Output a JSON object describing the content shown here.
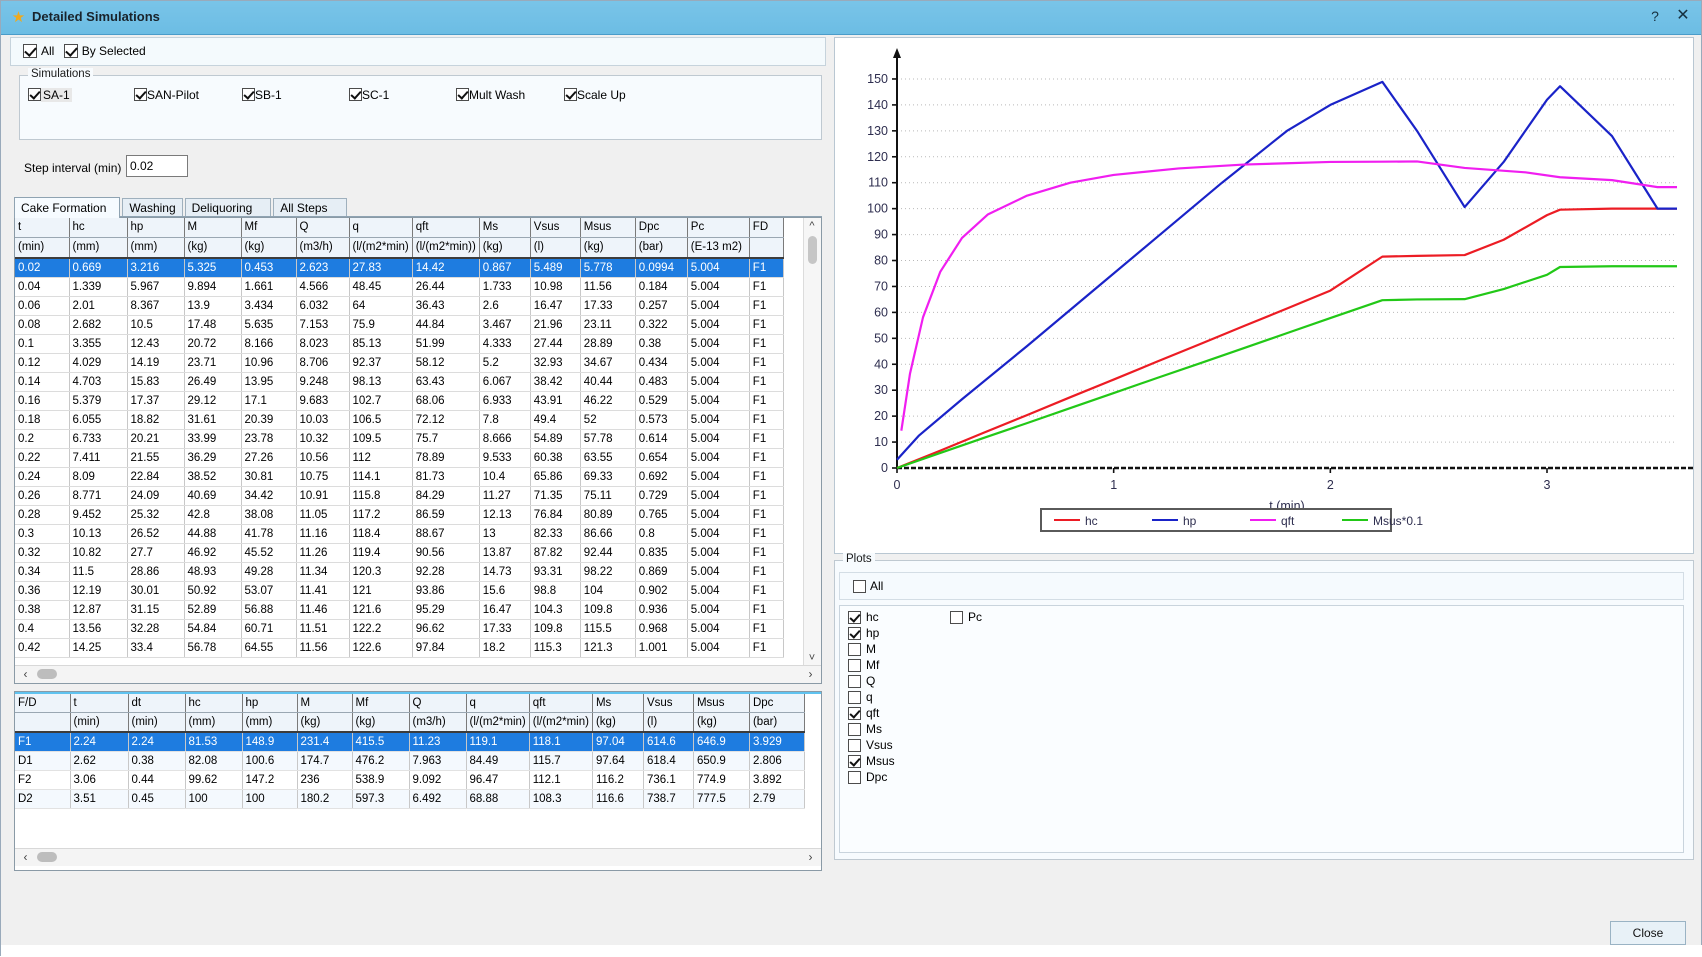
{
  "window": {
    "title": "Detailed Simulations",
    "star_icon": "star-icon",
    "help_label": "?",
    "close_label": "✕"
  },
  "top_filters": {
    "all_label": "All",
    "all_checked": true,
    "by_selected_label": "By Selected",
    "by_selected_checked": true
  },
  "simulations": {
    "group_title": "Simulations",
    "items": [
      {
        "label": "SA-1",
        "checked": true,
        "highlighted": true
      },
      {
        "label": "SAN-Pilot",
        "checked": true,
        "highlighted": false
      },
      {
        "label": "SB-1",
        "checked": true,
        "highlighted": false
      },
      {
        "label": "SC-1",
        "checked": true,
        "highlighted": false
      },
      {
        "label": "Mult Wash",
        "checked": true,
        "highlighted": false
      },
      {
        "label": "Scale Up",
        "checked": true,
        "highlighted": false
      }
    ]
  },
  "step_interval": {
    "label": "Step interval (min)",
    "value": "0.02"
  },
  "tabs": [
    {
      "label": "Cake Formation",
      "active": true
    },
    {
      "label": "Washing",
      "active": false
    },
    {
      "label": "Deliquoring",
      "active": false
    },
    {
      "label": "All Steps",
      "active": false
    }
  ],
  "main_table": {
    "columns": [
      "t",
      "hc",
      "hp",
      "M",
      "Mf",
      "Q",
      "q",
      "qft",
      "Ms",
      "Vsus",
      "Msus",
      "Dpc",
      "Pc",
      "FD"
    ],
    "units": [
      "(min)",
      "(mm)",
      "(mm)",
      "(kg)",
      "(kg)",
      "(m3/h)",
      "(l/(m2*min)",
      "(l/(m2*min))",
      "(kg)",
      "(l)",
      "(kg)",
      "(bar)",
      "(E-13 m2)",
      ""
    ],
    "selected_row": 0,
    "rows": [
      [
        "0.02",
        "0.669",
        "3.216",
        "5.325",
        "0.453",
        "2.623",
        "27.83",
        "14.42",
        "0.867",
        "5.489",
        "5.778",
        "0.0994",
        "5.004",
        "F1"
      ],
      [
        "0.04",
        "1.339",
        "5.967",
        "9.894",
        "1.661",
        "4.566",
        "48.45",
        "26.44",
        "1.733",
        "10.98",
        "11.56",
        "0.184",
        "5.004",
        "F1"
      ],
      [
        "0.06",
        "2.01",
        "8.367",
        "13.9",
        "3.434",
        "6.032",
        "64",
        "36.43",
        "2.6",
        "16.47",
        "17.33",
        "0.257",
        "5.004",
        "F1"
      ],
      [
        "0.08",
        "2.682",
        "10.5",
        "17.48",
        "5.635",
        "7.153",
        "75.9",
        "44.84",
        "3.467",
        "21.96",
        "23.11",
        "0.322",
        "5.004",
        "F1"
      ],
      [
        "0.1",
        "3.355",
        "12.43",
        "20.72",
        "8.166",
        "8.023",
        "85.13",
        "51.99",
        "4.333",
        "27.44",
        "28.89",
        "0.38",
        "5.004",
        "F1"
      ],
      [
        "0.12",
        "4.029",
        "14.19",
        "23.71",
        "10.96",
        "8.706",
        "92.37",
        "58.12",
        "5.2",
        "32.93",
        "34.67",
        "0.434",
        "5.004",
        "F1"
      ],
      [
        "0.14",
        "4.703",
        "15.83",
        "26.49",
        "13.95",
        "9.248",
        "98.13",
        "63.43",
        "6.067",
        "38.42",
        "40.44",
        "0.483",
        "5.004",
        "F1"
      ],
      [
        "0.16",
        "5.379",
        "17.37",
        "29.12",
        "17.1",
        "9.683",
        "102.7",
        "68.06",
        "6.933",
        "43.91",
        "46.22",
        "0.529",
        "5.004",
        "F1"
      ],
      [
        "0.18",
        "6.055",
        "18.82",
        "31.61",
        "20.39",
        "10.03",
        "106.5",
        "72.12",
        "7.8",
        "49.4",
        "52",
        "0.573",
        "5.004",
        "F1"
      ],
      [
        "0.2",
        "6.733",
        "20.21",
        "33.99",
        "23.78",
        "10.32",
        "109.5",
        "75.7",
        "8.666",
        "54.89",
        "57.78",
        "0.614",
        "5.004",
        "F1"
      ],
      [
        "0.22",
        "7.411",
        "21.55",
        "36.29",
        "27.26",
        "10.56",
        "112",
        "78.89",
        "9.533",
        "60.38",
        "63.55",
        "0.654",
        "5.004",
        "F1"
      ],
      [
        "0.24",
        "8.09",
        "22.84",
        "38.52",
        "30.81",
        "10.75",
        "114.1",
        "81.73",
        "10.4",
        "65.86",
        "69.33",
        "0.692",
        "5.004",
        "F1"
      ],
      [
        "0.26",
        "8.771",
        "24.09",
        "40.69",
        "34.42",
        "10.91",
        "115.8",
        "84.29",
        "11.27",
        "71.35",
        "75.11",
        "0.729",
        "5.004",
        "F1"
      ],
      [
        "0.28",
        "9.452",
        "25.32",
        "42.8",
        "38.08",
        "11.05",
        "117.2",
        "86.59",
        "12.13",
        "76.84",
        "80.89",
        "0.765",
        "5.004",
        "F1"
      ],
      [
        "0.3",
        "10.13",
        "26.52",
        "44.88",
        "41.78",
        "11.16",
        "118.4",
        "88.67",
        "13",
        "82.33",
        "86.66",
        "0.8",
        "5.004",
        "F1"
      ],
      [
        "0.32",
        "10.82",
        "27.7",
        "46.92",
        "45.52",
        "11.26",
        "119.4",
        "90.56",
        "13.87",
        "87.82",
        "92.44",
        "0.835",
        "5.004",
        "F1"
      ],
      [
        "0.34",
        "11.5",
        "28.86",
        "48.93",
        "49.28",
        "11.34",
        "120.3",
        "92.28",
        "14.73",
        "93.31",
        "98.22",
        "0.869",
        "5.004",
        "F1"
      ],
      [
        "0.36",
        "12.19",
        "30.01",
        "50.92",
        "53.07",
        "11.41",
        "121",
        "93.86",
        "15.6",
        "98.8",
        "104",
        "0.902",
        "5.004",
        "F1"
      ],
      [
        "0.38",
        "12.87",
        "31.15",
        "52.89",
        "56.88",
        "11.46",
        "121.6",
        "95.29",
        "16.47",
        "104.3",
        "109.8",
        "0.936",
        "5.004",
        "F1"
      ],
      [
        "0.4",
        "13.56",
        "32.28",
        "54.84",
        "60.71",
        "11.51",
        "122.2",
        "96.62",
        "17.33",
        "109.8",
        "115.5",
        "0.968",
        "5.004",
        "F1"
      ],
      [
        "0.42",
        "14.25",
        "33.4",
        "56.78",
        "64.55",
        "11.56",
        "122.6",
        "97.84",
        "18.2",
        "115.3",
        "121.3",
        "1.001",
        "5.004",
        "F1"
      ]
    ]
  },
  "fd_table": {
    "columns": [
      "F/D",
      "t",
      "dt",
      "hc",
      "hp",
      "M",
      "Mf",
      "Q",
      "q",
      "qft",
      "Ms",
      "Vsus",
      "Msus",
      "Dpc"
    ],
    "units": [
      "",
      "(min)",
      "(min)",
      "(mm)",
      "(mm)",
      "(kg)",
      "(kg)",
      "(m3/h)",
      "(l/(m2*min)",
      "(l/(m2*min)",
      "(kg)",
      "(l)",
      "(kg)",
      "(bar)"
    ],
    "selected_row": 0,
    "rows": [
      [
        "F1",
        "2.24",
        "2.24",
        "81.53",
        "148.9",
        "231.4",
        "415.5",
        "11.23",
        "119.1",
        "118.1",
        "97.04",
        "614.6",
        "646.9",
        "3.929"
      ],
      [
        "D1",
        "2.62",
        "0.38",
        "82.08",
        "100.6",
        "174.7",
        "476.2",
        "7.963",
        "84.49",
        "115.7",
        "97.64",
        "618.4",
        "650.9",
        "2.806"
      ],
      [
        "F2",
        "3.06",
        "0.44",
        "99.62",
        "147.2",
        "236",
        "538.9",
        "9.092",
        "96.47",
        "112.1",
        "116.2",
        "736.1",
        "774.9",
        "3.892"
      ],
      [
        "D2",
        "3.51",
        "0.45",
        "100",
        "100",
        "180.2",
        "597.3",
        "6.492",
        "68.88",
        "108.3",
        "116.6",
        "738.7",
        "777.5",
        "2.79"
      ]
    ]
  },
  "plots_panel": {
    "group_title": "Plots",
    "all_label": "All",
    "all_checked": false,
    "column1": [
      {
        "label": "hc",
        "checked": true
      },
      {
        "label": "hp",
        "checked": true
      },
      {
        "label": "M",
        "checked": false
      },
      {
        "label": "Mf",
        "checked": false
      },
      {
        "label": "Q",
        "checked": false
      },
      {
        "label": "q",
        "checked": false
      },
      {
        "label": "qft",
        "checked": true
      },
      {
        "label": "Ms",
        "checked": false
      },
      {
        "label": "Vsus",
        "checked": false
      },
      {
        "label": "Msus",
        "checked": true
      },
      {
        "label": "Dpc",
        "checked": false
      }
    ],
    "column2": [
      {
        "label": "Pc",
        "checked": false
      }
    ]
  },
  "footer": {
    "close_label": "Close"
  },
  "chart_data": {
    "type": "line",
    "title": "",
    "xlabel": "t (min)",
    "ylabel": "",
    "xlim": [
      0,
      3.6
    ],
    "ylim": [
      0,
      155
    ],
    "xticks": [
      0,
      1,
      2,
      3
    ],
    "yticks": [
      0,
      10,
      20,
      30,
      40,
      50,
      60,
      70,
      80,
      90,
      100,
      110,
      120,
      130,
      140,
      150
    ],
    "grid": true,
    "legend_position": "bottom",
    "series": [
      {
        "name": "hc",
        "color": "#ec1c24",
        "x": [
          0,
          0.2,
          0.4,
          0.6,
          0.8,
          1.0,
          1.2,
          1.4,
          1.6,
          1.8,
          2.0,
          2.24,
          2.4,
          2.62,
          2.8,
          3.0,
          3.06,
          3.3,
          3.51,
          3.6
        ],
        "y": [
          0,
          6.7,
          13.6,
          20.4,
          27.3,
          34.1,
          41.0,
          47.8,
          54.7,
          61.5,
          68.4,
          81.5,
          81.8,
          82.1,
          88.0,
          97.5,
          99.6,
          100,
          100,
          100
        ]
      },
      {
        "name": "hp",
        "color": "#1a23c8",
        "x": [
          0,
          0.1,
          0.3,
          0.6,
          0.9,
          1.2,
          1.5,
          1.8,
          2.0,
          2.24,
          2.4,
          2.62,
          2.8,
          3.0,
          3.06,
          3.3,
          3.51,
          3.6
        ],
        "y": [
          3.2,
          12.4,
          26.5,
          47.0,
          68.0,
          89.0,
          110.0,
          130.0,
          140.0,
          148.9,
          130.0,
          100.6,
          118.0,
          142.0,
          147.2,
          128.0,
          100,
          100
        ]
      },
      {
        "name": "qft",
        "color": "#f01ef0",
        "x": [
          0.02,
          0.06,
          0.12,
          0.2,
          0.3,
          0.42,
          0.6,
          0.8,
          1.0,
          1.3,
          1.6,
          1.8,
          2.0,
          2.24,
          2.4,
          2.62,
          2.9,
          3.06,
          3.3,
          3.51,
          3.6
        ],
        "y": [
          14.4,
          36.4,
          58.1,
          75.7,
          88.7,
          97.8,
          105.0,
          110.0,
          113.0,
          115.5,
          117.0,
          117.5,
          118.0,
          118.1,
          118.2,
          115.7,
          114.0,
          112.1,
          111.0,
          108.3,
          108.3
        ]
      },
      {
        "name": "Msus*0.1",
        "color": "#22c817",
        "x": [
          0,
          0.2,
          0.4,
          0.6,
          0.8,
          1.0,
          1.2,
          1.4,
          1.6,
          1.8,
          2.0,
          2.24,
          2.4,
          2.62,
          2.8,
          3.0,
          3.06,
          3.3,
          3.51,
          3.6
        ],
        "y": [
          0,
          5.8,
          11.6,
          17.3,
          23.1,
          28.9,
          34.7,
          40.4,
          46.2,
          52.0,
          57.8,
          64.7,
          65.0,
          65.1,
          69.0,
          74.5,
          77.5,
          77.8,
          77.8,
          77.8
        ]
      }
    ]
  }
}
